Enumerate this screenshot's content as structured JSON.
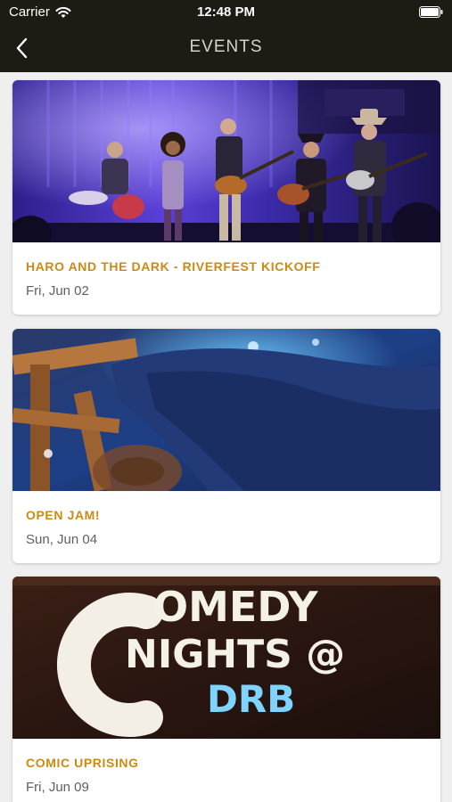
{
  "status": {
    "carrier": "Carrier",
    "time": "12:48 PM"
  },
  "nav": {
    "title": "EVENTS"
  },
  "events": [
    {
      "title": "HARO AND THE DARK - RIVERFEST KICKOFF",
      "date": "Fri, Jun 02"
    },
    {
      "title": "OPEN JAM!",
      "date": "Sun, Jun 04"
    },
    {
      "title": "COMIC UPRISING",
      "date": "Fri, Jun 09"
    }
  ],
  "comedy_poster": {
    "line1": "OMEDY",
    "line2": "NIGHTS @",
    "line3": "DRB"
  },
  "colors": {
    "bar_background": "#1e1b14",
    "event_title": "#cc8a13",
    "date_text": "#5f5f5f",
    "page_background": "#efefef"
  }
}
